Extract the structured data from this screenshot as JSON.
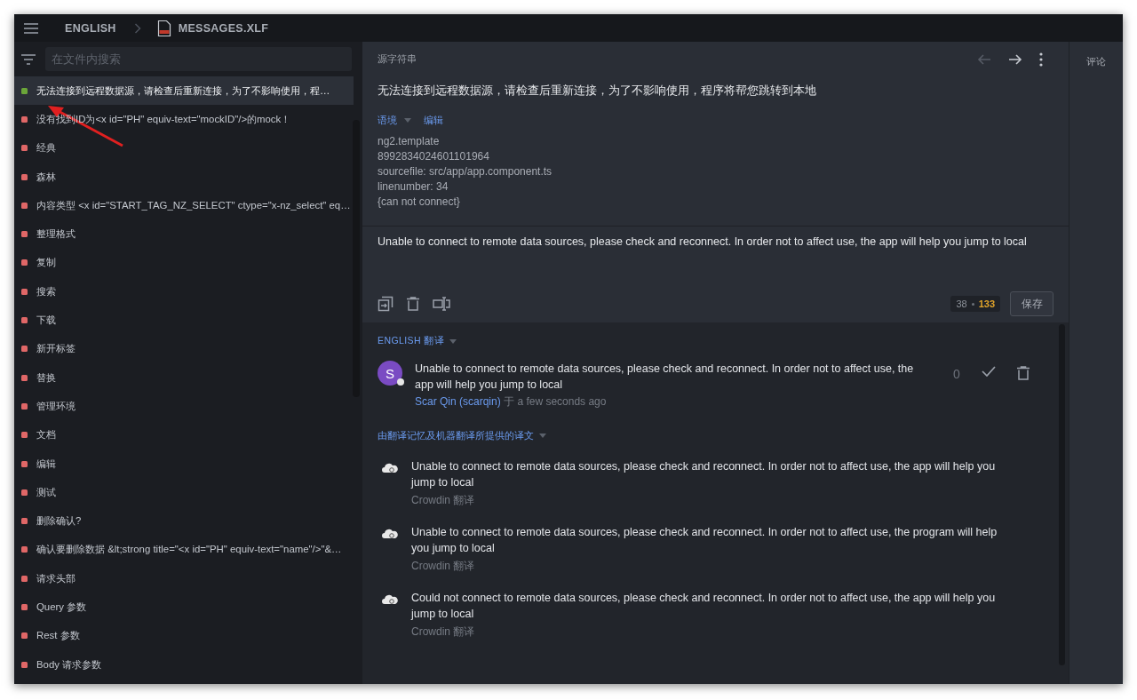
{
  "header": {
    "breadcrumb": [
      {
        "label": "ENGLISH",
        "kind": "language"
      },
      {
        "label": "MESSAGES.XLF",
        "kind": "file"
      }
    ]
  },
  "sidebar": {
    "search": {
      "placeholder": "在文件内搜索"
    },
    "items": [
      {
        "text": "无法连接到远程数据源，请检查后重新连接，为了不影响使用，程…",
        "selected": true,
        "color": "#6ba539"
      },
      {
        "text": "没有找到ID为<x id=\"PH\" equiv-text=\"mockID\"/>的mock！",
        "selected": false,
        "color": "#e06767"
      },
      {
        "text": "经典",
        "selected": false,
        "color": "#e06767"
      },
      {
        "text": "森林",
        "selected": false,
        "color": "#e06767"
      },
      {
        "text": "内容类型 <x id=\"START_TAG_NZ_SELECT\" ctype=\"x-nz_select\" eq…",
        "selected": false,
        "color": "#e06767"
      },
      {
        "text": "整理格式",
        "selected": false,
        "color": "#e06767"
      },
      {
        "text": "复制",
        "selected": false,
        "color": "#e06767"
      },
      {
        "text": "搜索",
        "selected": false,
        "color": "#e06767"
      },
      {
        "text": "下载",
        "selected": false,
        "color": "#e06767"
      },
      {
        "text": "新开标签",
        "selected": false,
        "color": "#e06767"
      },
      {
        "text": "替换",
        "selected": false,
        "color": "#e06767"
      },
      {
        "text": "管理环境",
        "selected": false,
        "color": "#e06767"
      },
      {
        "text": "文档",
        "selected": false,
        "color": "#e06767"
      },
      {
        "text": "编辑",
        "selected": false,
        "color": "#e06767"
      },
      {
        "text": "测试",
        "selected": false,
        "color": "#e06767"
      },
      {
        "text": "删除确认?",
        "selected": false,
        "color": "#e06767"
      },
      {
        "text": "确认要删除数据 &lt;strong title=\"<x id=\"PH\" equiv-text=\"name\"/>\"&…",
        "selected": false,
        "color": "#e06767"
      },
      {
        "text": "请求头部",
        "selected": false,
        "color": "#e06767"
      },
      {
        "text": "Query 参数",
        "selected": false,
        "color": "#e06767"
      },
      {
        "text": "Rest 参数",
        "selected": false,
        "color": "#e06767"
      },
      {
        "text": "Body 请求参数",
        "selected": false,
        "color": "#e06767"
      }
    ]
  },
  "source": {
    "heading": "源字符串",
    "text": "无法连接到远程数据源，请检查后重新连接，为了不影响使用，程序将帮您跳转到本地",
    "context_label": "语境",
    "edit_link": "编辑",
    "context_lines": [
      "ng2.template",
      "8992834024601101964",
      "sourcefile: src/app/app.component.ts",
      "linenumber: 34",
      "{can not connect}"
    ]
  },
  "editor": {
    "value": "Unable to connect to remote data sources, please check and reconnect. In order not to affect use, the app will help you jump to local",
    "count_typed": "38",
    "count_total": "133",
    "save_button": "保存"
  },
  "comments_tab": {
    "label": "评论"
  },
  "translations": {
    "heading": "ENGLISH 翻译",
    "items": [
      {
        "avatar_letter": "S",
        "text": "Unable to connect to remote data sources, please check and reconnect. In order not to affect use, the app will help you jump to local",
        "author": "Scar Qin (scarqin)",
        "time_prefix": "于",
        "time": "a few seconds ago",
        "votes": "0"
      }
    ]
  },
  "suggestions": {
    "heading": "由翻译记忆及机器翻译所提供的译文",
    "items": [
      {
        "text": "Unable to connect to remote data sources, please check and reconnect. In order not to affect use, the app will help you jump to local",
        "source": "Crowdin 翻译"
      },
      {
        "text": "Unable to connect to remote data sources, please check and reconnect. In order not to affect use, the program will help you jump to local",
        "source": "Crowdin 翻译"
      },
      {
        "text": "Could not connect to remote data sources, please check and reconnect. In order not to affect use, the app will help you jump to local",
        "source": "Crowdin 翻译"
      }
    ]
  }
}
